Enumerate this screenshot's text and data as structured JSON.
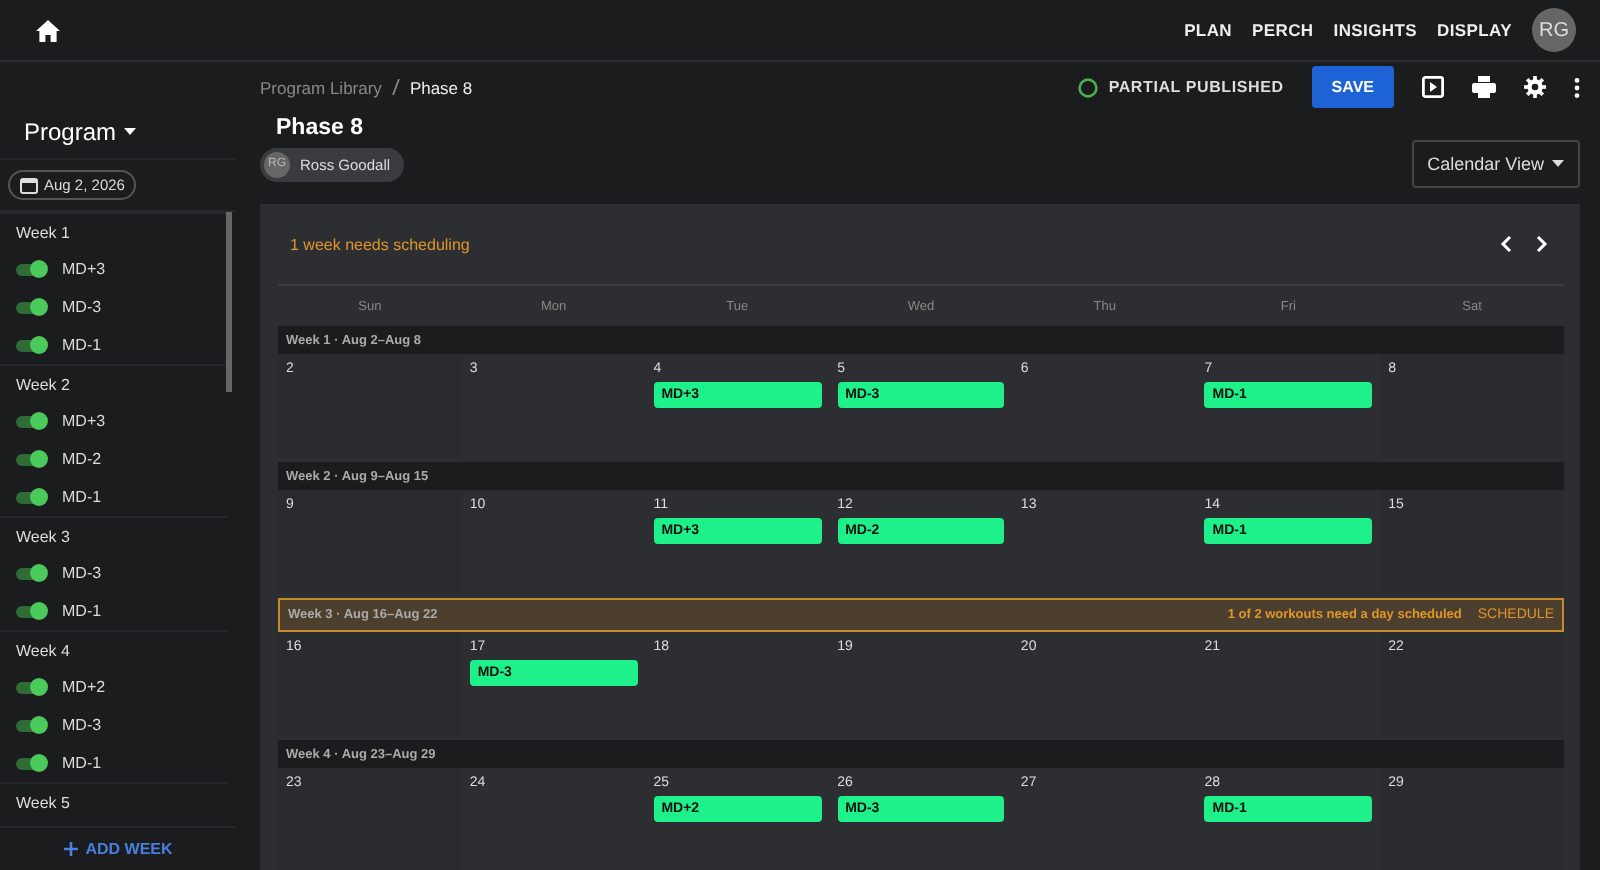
{
  "topbar": {
    "links": [
      {
        "label": "PLAN"
      },
      {
        "label": "PERCH"
      },
      {
        "label": "INSIGHTS"
      },
      {
        "label": "DISPLAY"
      }
    ],
    "avatar": "RG"
  },
  "sidebar": {
    "title": "Program",
    "date": "Aug 2, 2026",
    "add_week": "ADD WEEK",
    "weeks": [
      {
        "label": "Week 1",
        "sessions": [
          {
            "label": "MD+3",
            "on": true
          },
          {
            "label": "MD-3",
            "on": true
          },
          {
            "label": "MD-1",
            "on": true
          }
        ]
      },
      {
        "label": "Week 2",
        "sessions": [
          {
            "label": "MD+3",
            "on": true
          },
          {
            "label": "MD-2",
            "on": true
          },
          {
            "label": "MD-1",
            "on": true
          }
        ]
      },
      {
        "label": "Week 3",
        "sessions": [
          {
            "label": "MD-3",
            "on": true
          },
          {
            "label": "MD-1",
            "on": true
          }
        ]
      },
      {
        "label": "Week 4",
        "sessions": [
          {
            "label": "MD+2",
            "on": true
          },
          {
            "label": "MD-3",
            "on": true
          },
          {
            "label": "MD-1",
            "on": true
          }
        ]
      },
      {
        "label": "Week 5"
      }
    ]
  },
  "header": {
    "breadcrumb": [
      "Program Library",
      "Phase 8"
    ],
    "status": "PARTIAL PUBLISHED",
    "save": "SAVE"
  },
  "title": "Phase 8",
  "owner": {
    "initials": "RG",
    "name": "Ross Goodall"
  },
  "view_select": "Calendar View",
  "calendar": {
    "notice": "1 week needs scheduling",
    "weekdays": [
      "Sun",
      "Mon",
      "Tue",
      "Wed",
      "Thu",
      "Fri",
      "Sat"
    ],
    "weeks": [
      {
        "label": "Week 1 · Aug 2–Aug 8",
        "days": [
          {
            "date": "2"
          },
          {
            "date": "3"
          },
          {
            "date": "4",
            "workouts": [
              "MD+3"
            ]
          },
          {
            "date": "5",
            "workouts": [
              "MD-3"
            ]
          },
          {
            "date": "6"
          },
          {
            "date": "7",
            "workouts": [
              "MD-1"
            ]
          },
          {
            "date": "8"
          }
        ]
      },
      {
        "label": "Week 2 · Aug 9–Aug 15",
        "days": [
          {
            "date": "9"
          },
          {
            "date": "10"
          },
          {
            "date": "11",
            "workouts": [
              "MD+3"
            ]
          },
          {
            "date": "12",
            "workouts": [
              "MD-2"
            ]
          },
          {
            "date": "13"
          },
          {
            "date": "14",
            "workouts": [
              "MD-1"
            ]
          },
          {
            "date": "15"
          }
        ]
      },
      {
        "label": "Week 3 · Aug 16–Aug 22",
        "warning": {
          "message": "1 of 2 workouts need a day scheduled",
          "action": "SCHEDULE"
        },
        "days": [
          {
            "date": "16"
          },
          {
            "date": "17",
            "workouts": [
              "MD-3"
            ]
          },
          {
            "date": "18"
          },
          {
            "date": "19"
          },
          {
            "date": "20"
          },
          {
            "date": "21"
          },
          {
            "date": "22"
          }
        ]
      },
      {
        "label": "Week 4 · Aug 23–Aug 29",
        "days": [
          {
            "date": "23"
          },
          {
            "date": "24"
          },
          {
            "date": "25",
            "workouts": [
              "MD+2"
            ]
          },
          {
            "date": "26",
            "workouts": [
              "MD-3"
            ]
          },
          {
            "date": "27"
          },
          {
            "date": "28",
            "workouts": [
              "MD-1"
            ]
          },
          {
            "date": "29"
          }
        ]
      }
    ]
  }
}
